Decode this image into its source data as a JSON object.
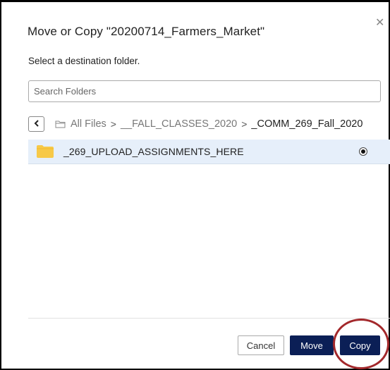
{
  "dialog": {
    "title": "Move or Copy \"20200714_Farmers_Market\"",
    "close_icon": "close-icon",
    "instruction": "Select a destination folder."
  },
  "search": {
    "placeholder": "Search Folders",
    "value": ""
  },
  "breadcrumb": {
    "back_icon": "chevron-left-icon",
    "folder_icon": "folder-outline-icon",
    "items": [
      "All Files",
      "__FALL_CLASSES_2020",
      "_COMM_269_Fall_2020"
    ],
    "separator": ">"
  },
  "folders": [
    {
      "name": "_269_UPLOAD_ASSIGNMENTS_HERE",
      "icon": "folder-icon",
      "has_children": true,
      "selected": true
    }
  ],
  "actions": {
    "cancel_label": "Cancel",
    "move_label": "Move",
    "copy_label": "Copy"
  },
  "colors": {
    "primary": "#0b1f56",
    "selected_row": "#e6effa",
    "folder_yellow": "#f7c948",
    "highlight_ring": "#a3282b"
  }
}
